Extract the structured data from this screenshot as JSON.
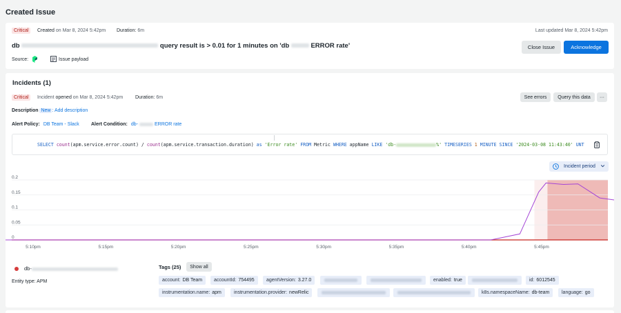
{
  "page": {
    "title": "Created Issue"
  },
  "issue": {
    "severity": "Critical",
    "created_label": "Created",
    "created_value": "on Mar 8, 2024 5:42pm",
    "duration_label": "Duration:",
    "duration_value": "6m",
    "last_updated": "Last updated Mar 8, 2024 5:42pm",
    "title_prefix": "db",
    "title_suffix": "query result is > 0.01 for 1 minutes on 'db",
    "title_end": "ERROR rate'",
    "source_label": "Source:",
    "issue_payload": "Issue payload",
    "close_button": "Close Issue",
    "ack_button": "Acknowledge"
  },
  "incidents": {
    "heading": "Incidents (1)",
    "severity": "Critical",
    "incident_label": "Incident",
    "opened_label": "opened",
    "opened_value": "on Mar 8, 2024 5:42pm",
    "duration_label": "Duration:",
    "duration_value": "6m",
    "see_errors": "See errors",
    "query_data": "Query this data",
    "more": "···",
    "description_label": "Description",
    "new_badge": "New",
    "add_description": ": Add description",
    "alert_policy_label": "Alert Policy:",
    "alert_policy_value": "DB Team - Slack",
    "alert_condition_label": "Alert Condition:",
    "alert_condition_prefix": "db-",
    "alert_condition_suffix": "ERROR rate",
    "query": {
      "select": "SELECT",
      "count1": "count",
      "arg1": "(apm.service.error.count)",
      "div": " / ",
      "count2": "count",
      "arg2": "(apm.service.transaction.duration)",
      "as": " as ",
      "alias": "'Error rate'",
      "from": " FROM ",
      "metric": "Metric ",
      "where": "WHERE ",
      "appname": "appName ",
      "like": "LIKE ",
      "like_prefix": "'db-",
      "like_suffix": "%'",
      "timeseries": " TIMESERIES ",
      "one": "1",
      "minute": " MINUTE ",
      "since": "SINCE ",
      "date": "'2024-03-08 11:43:40'",
      "tail": " UNT"
    },
    "period_button": "Incident period"
  },
  "chart_data": {
    "type": "line",
    "x": [
      "5:10pm",
      "5:15pm",
      "5:20pm",
      "5:25pm",
      "5:30pm",
      "5:35pm",
      "5:40pm",
      "5:45pm"
    ],
    "yticks": [
      "0.2",
      "0.15",
      "0.1",
      "0.05",
      "0"
    ],
    "ylim": [
      0,
      0.2
    ],
    "series": [
      {
        "x_minutes": [
          0,
          36.5,
          38.5,
          39.8,
          40.3,
          41.5,
          42.5,
          44.0,
          45.0
        ],
        "values": [
          0,
          0,
          0.02,
          0.16,
          0.19,
          0.185,
          0.187,
          0.14,
          0.133
        ],
        "color": "#a445d6"
      }
    ],
    "threshold": {
      "value": 0.01,
      "color": "#c8241f"
    },
    "incident_window_minutes": [
      40.4,
      49.0
    ],
    "pre_window_minutes": [
      39.5,
      40.4
    ]
  },
  "entity": {
    "name_prefix": "db-",
    "type_label": "Entity type: APM",
    "tags_label": "Tags (25)",
    "show_all": "Show all",
    "tags_row1": [
      {
        "k": "account:",
        "v": "DB Team"
      },
      {
        "k": "accountId:",
        "v": "754495"
      },
      {
        "k": "agentVersion:",
        "v": "3.27.0"
      },
      {
        "k": "",
        "v": ""
      },
      {
        "k": "",
        "v": ""
      },
      {
        "k": "enabled:",
        "v": "true"
      },
      {
        "k": "",
        "v": ""
      },
      {
        "k": "id:",
        "v": "6012545"
      }
    ],
    "tags_row2": [
      {
        "k": "instrumentation.name:",
        "v": "apm"
      },
      {
        "k": "instrumentation.provider:",
        "v": "newRelic"
      },
      {
        "k": "",
        "v": ""
      },
      {
        "k": "",
        "v": ""
      },
      {
        "k": "k8s.namespaceName:",
        "v": "db-team"
      },
      {
        "k": "language:",
        "v": "go"
      }
    ]
  }
}
